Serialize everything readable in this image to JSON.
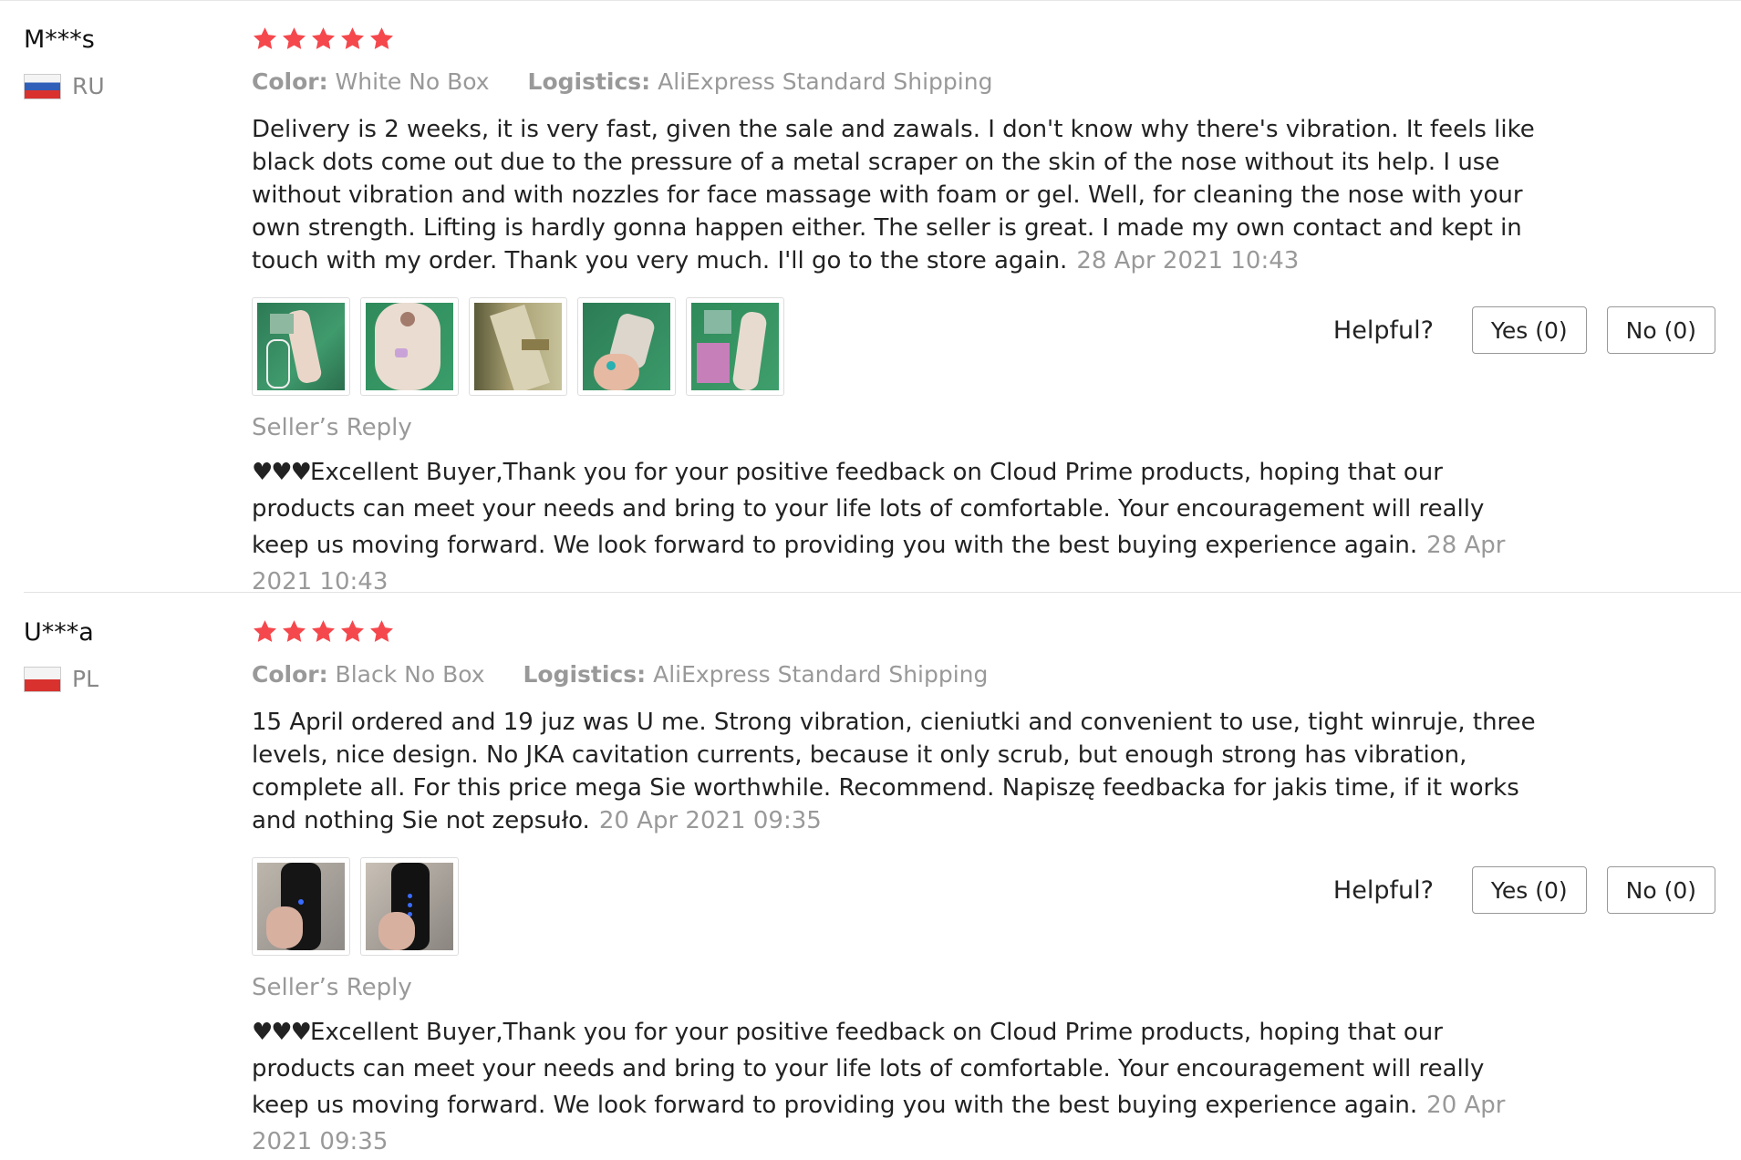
{
  "reviews": [
    {
      "user": "M***s",
      "country": "RU",
      "rating": 5,
      "color_label": "Color:",
      "color_value": "White No Box",
      "logistics_label": "Logistics:",
      "logistics_value": "AliExpress Standard Shipping",
      "text": "Delivery is 2 weeks, it is very fast, given the sale and zawals. I don't know why there's vibration. It feels like black dots come out due to the pressure of a metal scraper on the skin of the nose without its help. I use without vibration and with nozzles for face massage with foam or gel. Well, for cleaning the nose with your own strength. Lifting is hardly gonna happen either. The seller is great. I made my own contact and kept in touch with my order. Thank you very much. I'll go to the store again.",
      "date": "28 Apr 2021 10:43",
      "photos_count": 5,
      "helpful_label": "Helpful?",
      "yes_label": "Yes (0)",
      "no_label": "No (0)",
      "reply_title": "Seller’s Reply",
      "reply_hearts": "♥♥♥",
      "reply_text": "Excellent Buyer,Thank you for your positive feedback on Cloud Prime products, hoping that our products can meet your needs and bring to your life lots of comfortable. Your encouragement will really keep us moving forward. We look forward to providing you with the best buying experience again.",
      "reply_date": "28 Apr 2021 10:43"
    },
    {
      "user": "U***a",
      "country": "PL",
      "rating": 5,
      "color_label": "Color:",
      "color_value": "Black No Box",
      "logistics_label": "Logistics:",
      "logistics_value": "AliExpress Standard Shipping",
      "text": "15 April ordered and 19 juz was U me. Strong vibration, cieniutki and convenient to use, tight winruje, three levels, nice design. No JKA cavitation currents, because it only scrub, but enough strong has vibration, complete all. For this price mega Sie worthwhile. Recommend. Napiszę feedbacka for jakis time, if it works and nothing Sie not zepsuło.",
      "date": "20 Apr 2021 09:35",
      "photos_count": 2,
      "helpful_label": "Helpful?",
      "yes_label": "Yes (0)",
      "no_label": "No (0)",
      "reply_title": "Seller’s Reply",
      "reply_hearts": "♥♥♥",
      "reply_text": "Excellent Buyer,Thank you for your positive feedback on Cloud Prime products, hoping that our products can meet your needs and bring to your life lots of comfortable. Your encouragement will really keep us moving forward. We look forward to providing you with the best buying experience again.",
      "reply_date": "20 Apr 2021 09:35"
    }
  ],
  "colors": {
    "star": "#f5484d",
    "muted_text": "#999999",
    "body_text": "#222222",
    "border": "#dddddd"
  },
  "icons": {
    "star": "star-icon",
    "heart": "heart-icon",
    "flag_ru": "flag-ru-icon",
    "flag_pl": "flag-pl-icon"
  }
}
